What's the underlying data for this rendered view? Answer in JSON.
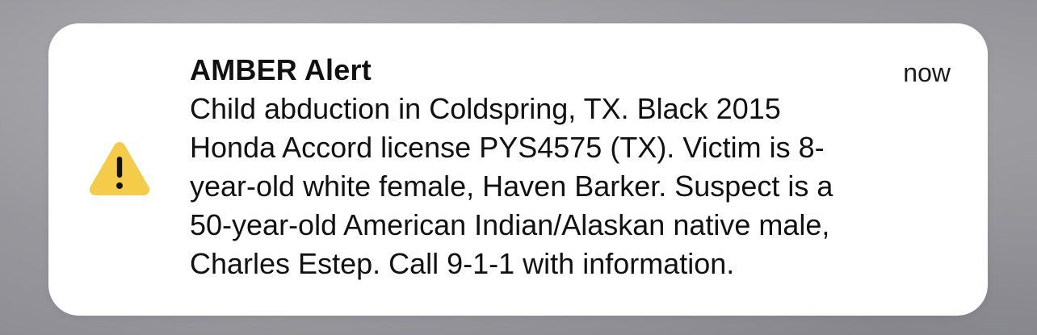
{
  "notification": {
    "title": "AMBER Alert",
    "time": "now",
    "icon": "warning-triangle-icon",
    "icon_color": "#F5CB4A",
    "body_lines": [
      "Child abduction in Coldspring, TX. Black 2015",
      "Honda Accord license PYS4575 (TX). Victim is 8-",
      "year-old white female, Haven Barker. Suspect is a",
      "50-year-old American Indian/Alaskan native male,",
      "Charles Estep. Call 9-1-1 with information."
    ]
  }
}
